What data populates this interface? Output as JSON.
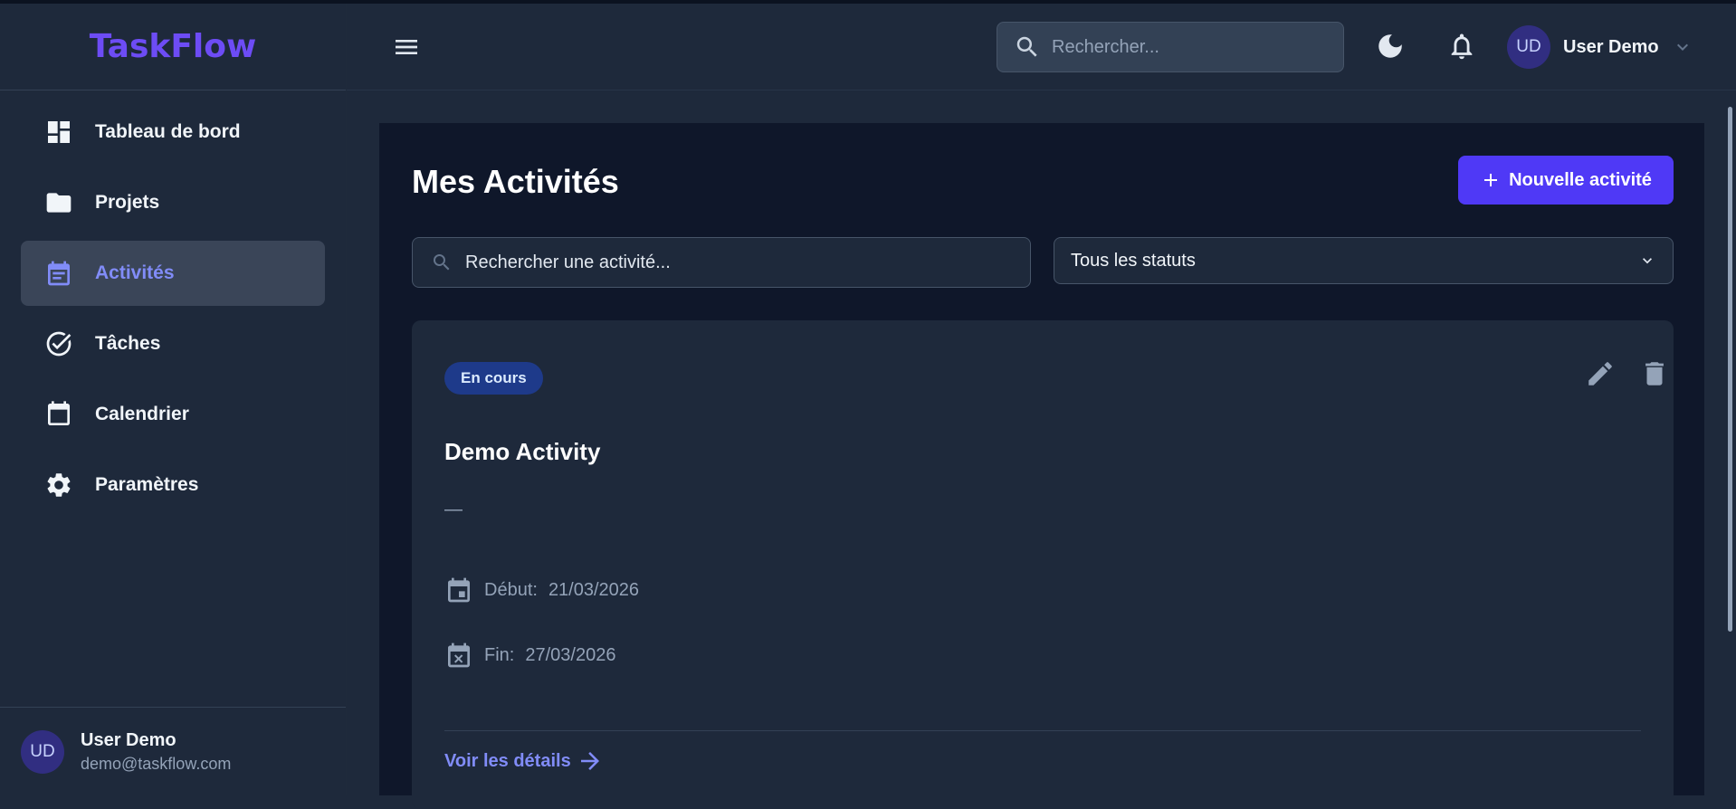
{
  "app": {
    "brand": "TaskFlow"
  },
  "header": {
    "search_placeholder": "Rechercher...",
    "user_initials": "UD",
    "user_name": "User Demo"
  },
  "sidebar": {
    "items": [
      {
        "label": "Tableau de bord",
        "icon": "dashboard-icon",
        "active": false
      },
      {
        "label": "Projets",
        "icon": "folder-icon",
        "active": false
      },
      {
        "label": "Activités",
        "icon": "calendar-event-icon",
        "active": true
      },
      {
        "label": "Tâches",
        "icon": "check-circle-icon",
        "active": false
      },
      {
        "label": "Calendrier",
        "icon": "calendar-icon",
        "active": false
      },
      {
        "label": "Paramètres",
        "icon": "gear-icon",
        "active": false
      }
    ],
    "user": {
      "initials": "UD",
      "name": "User Demo",
      "email": "demo@taskflow.com"
    }
  },
  "main": {
    "title": "Mes Activités",
    "new_button": "Nouvelle activité",
    "search_placeholder": "Rechercher une activité...",
    "status_filter": {
      "selected": "Tous les statuts"
    },
    "activities": [
      {
        "status": "En cours",
        "title": "Demo Activity",
        "description": "—",
        "start_label": "Début:",
        "start_date": "21/03/2026",
        "end_label": "Fin:",
        "end_date": "27/03/2026",
        "details_link": "Voir les détails"
      }
    ]
  },
  "colors": {
    "accent": "#4f39f6",
    "link": "#818cf8",
    "brand": "#6d4cf5",
    "badge_bg": "#1e3a8a"
  }
}
